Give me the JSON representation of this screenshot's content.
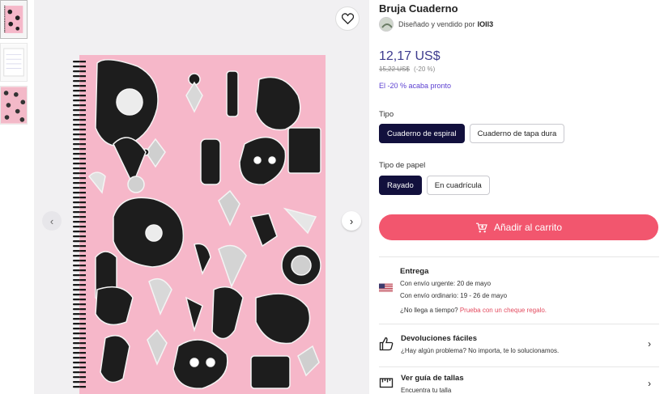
{
  "product": {
    "title": "Bruja Cuaderno",
    "seller_prefix": "Diseñado y vendido por",
    "seller_name": "IOIl3",
    "price": "12,17 US$",
    "old_price": "15,22 US$",
    "discount_pct": "(-20 %)",
    "discount_note": "El -20 % acaba pronto"
  },
  "options": {
    "type_label": "Tipo",
    "types": [
      "Cuaderno de espiral",
      "Cuaderno de tapa dura"
    ],
    "paper_label": "Tipo de papel",
    "papers": [
      "Rayado",
      "En cuadrícula"
    ]
  },
  "cart": {
    "label": "Añadir al carrito"
  },
  "delivery": {
    "title": "Entrega",
    "urgent": "Con envío urgente: 20 de mayo",
    "standard": "Con envío ordinario: 19 - 26 de mayo",
    "late_q": "¿No llega a tiempo?",
    "late_link": "Prueba con un cheque regalo."
  },
  "returns": {
    "title": "Devoluciones fáciles",
    "subtitle": "¿Hay algún problema? No importa, te lo solucionamos."
  },
  "size_guide": {
    "title": "Ver guía de tallas",
    "subtitle": "Encuentra tu talla"
  },
  "icons": {
    "favorite": "heart-icon",
    "prev": "chevron-left-icon",
    "next": "chevron-right-icon",
    "cart": "cart-icon",
    "flag": "us-flag-icon",
    "returns": "thumbs-up-icon",
    "size": "ruler-icon"
  },
  "colors": {
    "price": "#3d3b8e",
    "discount": "#5b3fd1",
    "selected_option": "#12103d",
    "cart": "#f2566e",
    "link": "#e34b5f",
    "cover_pink": "#f5b8c9"
  }
}
